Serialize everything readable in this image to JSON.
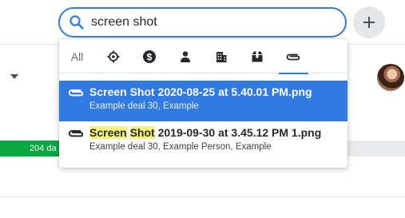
{
  "search": {
    "query": "screen shot"
  },
  "background": {
    "stage_label": "204 da"
  },
  "tabs": [
    {
      "label": "All",
      "icon": "all"
    },
    {
      "label": "",
      "icon": "leads-target-icon"
    },
    {
      "label": "",
      "icon": "deals-dollar-icon"
    },
    {
      "label": "",
      "icon": "person-icon"
    },
    {
      "label": "",
      "icon": "organization-building-icon"
    },
    {
      "label": "",
      "icon": "products-box-icon"
    },
    {
      "label": "",
      "icon": "files-paperclip-icon"
    }
  ],
  "results": [
    {
      "title": "Screen Shot 2020-08-25 at 5.40.01 PM.png",
      "subtitle": "Example deal 30, Example",
      "selected": true
    },
    {
      "title_highlight_1": "Screen",
      "title_highlight_2": "Shot",
      "title_rest": " 2019-09-30 at 3.45.12 PM 1.png",
      "subtitle": "Example deal 30, Example Person, Example",
      "selected": false
    }
  ],
  "colors": {
    "accent": "#317ae2",
    "highlight": "#fbf27a",
    "stage_green": "#08a742"
  }
}
